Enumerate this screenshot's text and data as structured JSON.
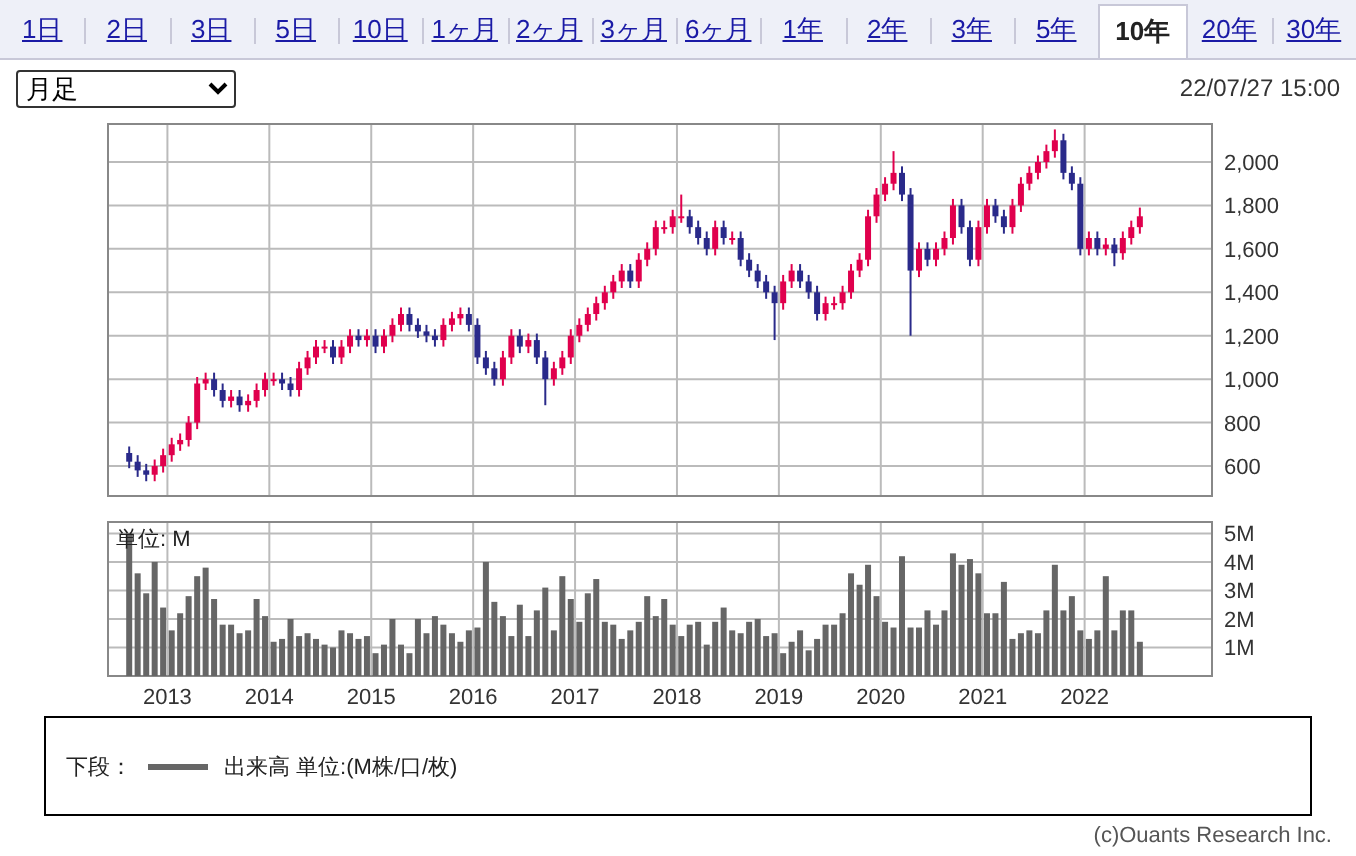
{
  "tabs": [
    {
      "label": "1日",
      "selected": false
    },
    {
      "label": "2日",
      "selected": false
    },
    {
      "label": "3日",
      "selected": false
    },
    {
      "label": "5日",
      "selected": false
    },
    {
      "label": "10日",
      "selected": false
    },
    {
      "label": "1ヶ月",
      "selected": false
    },
    {
      "label": "2ヶ月",
      "selected": false
    },
    {
      "label": "3ヶ月",
      "selected": false
    },
    {
      "label": "6ヶ月",
      "selected": false
    },
    {
      "label": "1年",
      "selected": false
    },
    {
      "label": "2年",
      "selected": false
    },
    {
      "label": "3年",
      "selected": false
    },
    {
      "label": "5年",
      "selected": false
    },
    {
      "label": "10年",
      "selected": true
    },
    {
      "label": "20年",
      "selected": false
    },
    {
      "label": "30年",
      "selected": false
    }
  ],
  "period_select": {
    "value": "月足"
  },
  "timestamp": "22/07/27 15:00",
  "price_chart": {
    "chart_data": {
      "type": "candlestick",
      "grid": true,
      "xlim": [
        2012.417,
        2023.25
      ],
      "ylim": [
        462,
        2175
      ],
      "yticks": [
        {
          "value": 600,
          "label": "600"
        },
        {
          "value": 800,
          "label": "800"
        },
        {
          "value": 1000,
          "label": "1,000"
        },
        {
          "value": 1200,
          "label": "1,200"
        },
        {
          "value": 1400,
          "label": "1,400"
        },
        {
          "value": 1600,
          "label": "1,600"
        },
        {
          "value": 1800,
          "label": "1,800"
        },
        {
          "value": 2000,
          "label": "2,000"
        }
      ],
      "x": [
        2012.625,
        2012.708,
        2012.792,
        2012.875,
        2012.958,
        2013.042,
        2013.125,
        2013.208,
        2013.292,
        2013.375,
        2013.458,
        2013.542,
        2013.625,
        2013.708,
        2013.792,
        2013.875,
        2013.958,
        2014.042,
        2014.125,
        2014.208,
        2014.292,
        2014.375,
        2014.458,
        2014.542,
        2014.625,
        2014.708,
        2014.792,
        2014.875,
        2014.958,
        2015.042,
        2015.125,
        2015.208,
        2015.292,
        2015.375,
        2015.458,
        2015.542,
        2015.625,
        2015.708,
        2015.792,
        2015.875,
        2015.958,
        2016.042,
        2016.125,
        2016.208,
        2016.292,
        2016.375,
        2016.458,
        2016.542,
        2016.625,
        2016.708,
        2016.792,
        2016.875,
        2016.958,
        2017.042,
        2017.125,
        2017.208,
        2017.292,
        2017.375,
        2017.458,
        2017.542,
        2017.625,
        2017.708,
        2017.792,
        2017.875,
        2017.958,
        2018.042,
        2018.125,
        2018.208,
        2018.292,
        2018.375,
        2018.458,
        2018.542,
        2018.625,
        2018.708,
        2018.792,
        2018.875,
        2018.958,
        2019.042,
        2019.125,
        2019.208,
        2019.292,
        2019.375,
        2019.458,
        2019.542,
        2019.625,
        2019.708,
        2019.792,
        2019.875,
        2019.958,
        2020.042,
        2020.125,
        2020.208,
        2020.292,
        2020.375,
        2020.458,
        2020.542,
        2020.625,
        2020.708,
        2020.792,
        2020.875,
        2020.958,
        2021.042,
        2021.125,
        2021.208,
        2021.292,
        2021.375,
        2021.458,
        2021.542,
        2021.625,
        2021.708,
        2021.792,
        2021.875,
        2021.958,
        2022.042,
        2022.125,
        2022.208,
        2022.292,
        2022.375,
        2022.458,
        2022.542
      ],
      "ohlc": [
        [
          660,
          690,
          590,
          620
        ],
        [
          620,
          650,
          550,
          580
        ],
        [
          580,
          610,
          530,
          560
        ],
        [
          560,
          630,
          530,
          600
        ],
        [
          600,
          680,
          570,
          650
        ],
        [
          650,
          730,
          620,
          700
        ],
        [
          700,
          750,
          670,
          720
        ],
        [
          720,
          830,
          690,
          800
        ],
        [
          800,
          1010,
          770,
          980
        ],
        [
          980,
          1030,
          950,
          1000
        ],
        [
          1000,
          1030,
          920,
          950
        ],
        [
          950,
          980,
          870,
          900
        ],
        [
          900,
          950,
          870,
          920
        ],
        [
          920,
          950,
          850,
          880
        ],
        [
          880,
          930,
          850,
          900
        ],
        [
          900,
          980,
          870,
          950
        ],
        [
          950,
          1030,
          920,
          1000
        ],
        [
          1000,
          1030,
          970,
          1000
        ],
        [
          1000,
          1030,
          950,
          980
        ],
        [
          980,
          1010,
          920,
          950
        ],
        [
          950,
          1080,
          920,
          1050
        ],
        [
          1050,
          1130,
          1020,
          1100
        ],
        [
          1100,
          1180,
          1070,
          1150
        ],
        [
          1150,
          1180,
          1120,
          1150
        ],
        [
          1150,
          1180,
          1070,
          1100
        ],
        [
          1100,
          1180,
          1070,
          1150
        ],
        [
          1150,
          1230,
          1120,
          1200
        ],
        [
          1200,
          1230,
          1150,
          1180
        ],
        [
          1180,
          1230,
          1150,
          1200
        ],
        [
          1200,
          1230,
          1120,
          1150
        ],
        [
          1150,
          1230,
          1120,
          1200
        ],
        [
          1200,
          1280,
          1170,
          1250
        ],
        [
          1250,
          1330,
          1220,
          1300
        ],
        [
          1300,
          1330,
          1220,
          1250
        ],
        [
          1250,
          1280,
          1190,
          1220
        ],
        [
          1220,
          1250,
          1170,
          1200
        ],
        [
          1200,
          1230,
          1150,
          1180
        ],
        [
          1180,
          1280,
          1150,
          1250
        ],
        [
          1250,
          1310,
          1220,
          1280
        ],
        [
          1280,
          1330,
          1250,
          1300
        ],
        [
          1300,
          1330,
          1220,
          1250
        ],
        [
          1250,
          1280,
          1070,
          1100
        ],
        [
          1100,
          1130,
          1020,
          1050
        ],
        [
          1050,
          1080,
          970,
          1000
        ],
        [
          1000,
          1130,
          970,
          1100
        ],
        [
          1100,
          1230,
          1070,
          1200
        ],
        [
          1200,
          1230,
          1120,
          1150
        ],
        [
          1150,
          1210,
          1120,
          1180
        ],
        [
          1180,
          1210,
          1070,
          1100
        ],
        [
          1100,
          1130,
          880,
          1000
        ],
        [
          1000,
          1080,
          970,
          1050
        ],
        [
          1050,
          1130,
          1020,
          1100
        ],
        [
          1100,
          1230,
          1070,
          1200
        ],
        [
          1200,
          1280,
          1170,
          1250
        ],
        [
          1250,
          1330,
          1220,
          1300
        ],
        [
          1300,
          1380,
          1270,
          1350
        ],
        [
          1350,
          1430,
          1320,
          1400
        ],
        [
          1400,
          1480,
          1370,
          1450
        ],
        [
          1450,
          1530,
          1420,
          1500
        ],
        [
          1500,
          1530,
          1420,
          1450
        ],
        [
          1450,
          1580,
          1420,
          1550
        ],
        [
          1550,
          1630,
          1520,
          1600
        ],
        [
          1600,
          1730,
          1570,
          1700
        ],
        [
          1700,
          1730,
          1670,
          1700
        ],
        [
          1700,
          1780,
          1670,
          1750
        ],
        [
          1750,
          1850,
          1720,
          1750
        ],
        [
          1750,
          1780,
          1670,
          1700
        ],
        [
          1700,
          1730,
          1620,
          1650
        ],
        [
          1650,
          1680,
          1570,
          1600
        ],
        [
          1600,
          1730,
          1570,
          1700
        ],
        [
          1700,
          1730,
          1620,
          1650
        ],
        [
          1650,
          1680,
          1620,
          1650
        ],
        [
          1650,
          1680,
          1520,
          1550
        ],
        [
          1550,
          1580,
          1470,
          1500
        ],
        [
          1500,
          1530,
          1420,
          1450
        ],
        [
          1450,
          1480,
          1370,
          1400
        ],
        [
          1400,
          1430,
          1180,
          1350
        ],
        [
          1350,
          1480,
          1320,
          1450
        ],
        [
          1450,
          1530,
          1420,
          1500
        ],
        [
          1500,
          1530,
          1420,
          1450
        ],
        [
          1450,
          1480,
          1370,
          1400
        ],
        [
          1400,
          1430,
          1270,
          1300
        ],
        [
          1300,
          1380,
          1270,
          1350
        ],
        [
          1350,
          1380,
          1320,
          1350
        ],
        [
          1350,
          1430,
          1320,
          1400
        ],
        [
          1400,
          1530,
          1370,
          1500
        ],
        [
          1500,
          1580,
          1470,
          1550
        ],
        [
          1550,
          1780,
          1520,
          1750
        ],
        [
          1750,
          1880,
          1720,
          1850
        ],
        [
          1850,
          1930,
          1820,
          1900
        ],
        [
          1900,
          2050,
          1870,
          1950
        ],
        [
          1950,
          1980,
          1820,
          1850
        ],
        [
          1850,
          1880,
          1200,
          1500
        ],
        [
          1500,
          1630,
          1470,
          1600
        ],
        [
          1600,
          1630,
          1520,
          1550
        ],
        [
          1550,
          1630,
          1520,
          1600
        ],
        [
          1600,
          1680,
          1570,
          1650
        ],
        [
          1650,
          1830,
          1620,
          1800
        ],
        [
          1800,
          1830,
          1670,
          1700
        ],
        [
          1700,
          1730,
          1520,
          1550
        ],
        [
          1550,
          1730,
          1520,
          1700
        ],
        [
          1700,
          1830,
          1670,
          1800
        ],
        [
          1800,
          1830,
          1720,
          1750
        ],
        [
          1750,
          1780,
          1670,
          1700
        ],
        [
          1700,
          1830,
          1670,
          1800
        ],
        [
          1800,
          1930,
          1770,
          1900
        ],
        [
          1900,
          1980,
          1870,
          1950
        ],
        [
          1950,
          2030,
          1920,
          2000
        ],
        [
          2000,
          2080,
          1970,
          2050
        ],
        [
          2050,
          2150,
          2020,
          2100
        ],
        [
          2100,
          2130,
          1920,
          1950
        ],
        [
          1950,
          1980,
          1870,
          1900
        ],
        [
          1900,
          1930,
          1570,
          1600
        ],
        [
          1600,
          1680,
          1570,
          1650
        ],
        [
          1650,
          1680,
          1570,
          1600
        ],
        [
          1600,
          1650,
          1570,
          1620
        ],
        [
          1620,
          1650,
          1520,
          1580
        ],
        [
          1580,
          1680,
          1550,
          1650
        ],
        [
          1650,
          1730,
          1620,
          1700
        ],
        [
          1700,
          1790,
          1670,
          1750
        ]
      ]
    }
  },
  "volume_chart": {
    "unit_label": "単位: M",
    "chart_data": {
      "type": "bar",
      "grid": true,
      "xlim": [
        2012.417,
        2023.25
      ],
      "ylim": [
        0,
        5.4
      ],
      "yticks": [
        {
          "value": 1,
          "label": "1M"
        },
        {
          "value": 2,
          "label": "2M"
        },
        {
          "value": 3,
          "label": "3M"
        },
        {
          "value": 4,
          "label": "4M"
        },
        {
          "value": 5,
          "label": "5M"
        }
      ],
      "xticks": [
        2013,
        2014,
        2015,
        2016,
        2017,
        2018,
        2019,
        2020,
        2021,
        2022
      ],
      "x": [
        2012.625,
        2012.708,
        2012.792,
        2012.875,
        2012.958,
        2013.042,
        2013.125,
        2013.208,
        2013.292,
        2013.375,
        2013.458,
        2013.542,
        2013.625,
        2013.708,
        2013.792,
        2013.875,
        2013.958,
        2014.042,
        2014.125,
        2014.208,
        2014.292,
        2014.375,
        2014.458,
        2014.542,
        2014.625,
        2014.708,
        2014.792,
        2014.875,
        2014.958,
        2015.042,
        2015.125,
        2015.208,
        2015.292,
        2015.375,
        2015.458,
        2015.542,
        2015.625,
        2015.708,
        2015.792,
        2015.875,
        2015.958,
        2016.042,
        2016.125,
        2016.208,
        2016.292,
        2016.375,
        2016.458,
        2016.542,
        2016.625,
        2016.708,
        2016.792,
        2016.875,
        2016.958,
        2017.042,
        2017.125,
        2017.208,
        2017.292,
        2017.375,
        2017.458,
        2017.542,
        2017.625,
        2017.708,
        2017.792,
        2017.875,
        2017.958,
        2018.042,
        2018.125,
        2018.208,
        2018.292,
        2018.375,
        2018.458,
        2018.542,
        2018.625,
        2018.708,
        2018.792,
        2018.875,
        2018.958,
        2019.042,
        2019.125,
        2019.208,
        2019.292,
        2019.375,
        2019.458,
        2019.542,
        2019.625,
        2019.708,
        2019.792,
        2019.875,
        2019.958,
        2020.042,
        2020.125,
        2020.208,
        2020.292,
        2020.375,
        2020.458,
        2020.542,
        2020.625,
        2020.708,
        2020.792,
        2020.875,
        2020.958,
        2021.042,
        2021.125,
        2021.208,
        2021.292,
        2021.375,
        2021.458,
        2021.542,
        2021.625,
        2021.708,
        2021.792,
        2021.875,
        2021.958,
        2022.042,
        2022.125,
        2022.208,
        2022.292,
        2022.375,
        2022.458,
        2022.542
      ],
      "values": [
        5.0,
        3.6,
        2.9,
        4.0,
        2.4,
        1.6,
        2.2,
        2.8,
        3.5,
        3.8,
        2.7,
        1.8,
        1.8,
        1.5,
        1.6,
        2.7,
        2.1,
        1.2,
        1.3,
        2.0,
        1.4,
        1.5,
        1.3,
        1.1,
        1.0,
        1.6,
        1.5,
        1.3,
        1.4,
        0.8,
        1.1,
        2.0,
        1.1,
        0.8,
        2.0,
        1.5,
        2.1,
        1.8,
        1.5,
        1.2,
        1.6,
        1.7,
        4.0,
        2.6,
        2.1,
        1.4,
        2.5,
        1.4,
        2.3,
        3.1,
        1.6,
        3.5,
        2.7,
        1.9,
        2.9,
        3.4,
        1.9,
        1.8,
        1.3,
        1.6,
        1.9,
        2.8,
        2.1,
        2.7,
        1.8,
        1.4,
        1.8,
        1.9,
        1.1,
        1.9,
        2.4,
        1.6,
        1.5,
        1.9,
        2.0,
        1.4,
        1.5,
        0.8,
        1.2,
        1.6,
        0.9,
        1.3,
        1.8,
        1.8,
        2.2,
        3.6,
        3.2,
        3.9,
        2.8,
        1.9,
        1.7,
        4.2,
        1.7,
        1.7,
        2.3,
        1.8,
        2.3,
        4.3,
        3.9,
        4.1,
        3.6,
        2.2,
        2.2,
        3.3,
        1.3,
        1.5,
        1.6,
        1.5,
        2.3,
        3.9,
        2.3,
        2.8,
        1.6,
        1.3,
        1.6,
        3.5,
        1.6,
        2.3,
        2.3,
        1.2
      ]
    }
  },
  "legend": {
    "prefix": "下段：",
    "label": "出来高 単位:(M株/口/枚)"
  },
  "copyright": "(c)Ouants Research Inc."
}
